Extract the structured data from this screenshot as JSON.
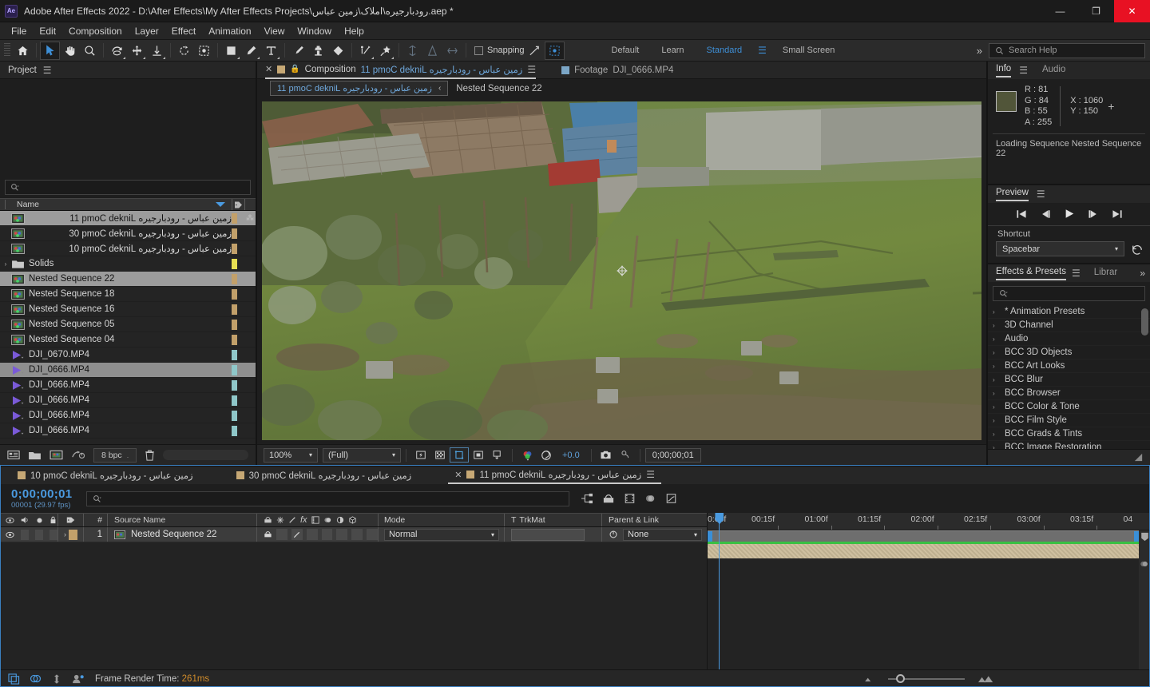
{
  "titlebar": {
    "app_icon": "ae-logo",
    "title": "Adobe After Effects 2022 - D:\\After Effects\\My After Effects Projects\\رودبارجیره\\املاک\\زمین عباس.aep *",
    "minimize": "—",
    "maximize": "❐",
    "close": "✕"
  },
  "menubar": {
    "items": [
      "File",
      "Edit",
      "Composition",
      "Layer",
      "Effect",
      "Animation",
      "View",
      "Window",
      "Help"
    ]
  },
  "toolbar": {
    "snapping_label": "Snapping",
    "workspaces": [
      "Default",
      "Learn",
      "Standard",
      "Small Screen"
    ],
    "selected_workspace": "Standard",
    "overflow": "»",
    "help_placeholder": "Search Help"
  },
  "project": {
    "tab_label": "Project",
    "search_placeholder": "",
    "columns": [
      "Name"
    ],
    "items": [
      {
        "name": "زمین عباس - رودبارجیره Linked Comp 11",
        "type": "comp",
        "swatch": "#c2a06a",
        "selected": true,
        "rtl": true,
        "hierarchy": true
      },
      {
        "name": "زمین عباس - رودبارجیره Linked Comp 03",
        "type": "comp",
        "swatch": "#c2a06a",
        "selected": false,
        "rtl": true
      },
      {
        "name": "زمین عباس - رودبارجیره Linked Comp 01",
        "type": "comp",
        "swatch": "#c2a06a",
        "selected": false,
        "rtl": true
      },
      {
        "name": "Solids",
        "type": "folder",
        "swatch": "#e8df52",
        "selected": false,
        "twisty": true
      },
      {
        "name": "Nested Sequence 22",
        "type": "comp",
        "swatch": "#c2a06a",
        "selected": true
      },
      {
        "name": "Nested Sequence 18",
        "type": "comp",
        "swatch": "#c2a06a",
        "selected": false
      },
      {
        "name": "Nested Sequence 16",
        "type": "comp",
        "swatch": "#c2a06a",
        "selected": false
      },
      {
        "name": "Nested Sequence 05",
        "type": "comp",
        "swatch": "#c2a06a",
        "selected": false
      },
      {
        "name": "Nested Sequence 04",
        "type": "comp",
        "swatch": "#c2a06a",
        "selected": false
      },
      {
        "name": "DJI_0670.MP4",
        "type": "video",
        "swatch": "#8fc7c9",
        "selected": false
      },
      {
        "name": "DJI_0666.MP4",
        "type": "video",
        "swatch": "#8fc7c9",
        "selected": true
      },
      {
        "name": "DJI_0666.MP4",
        "type": "video",
        "swatch": "#8fc7c9",
        "selected": false
      },
      {
        "name": "DJI_0666.MP4",
        "type": "video",
        "swatch": "#8fc7c9",
        "selected": false
      },
      {
        "name": "DJI_0666.MP4",
        "type": "video",
        "swatch": "#8fc7c9",
        "selected": false
      },
      {
        "name": "DJI_0666.MP4",
        "type": "video",
        "swatch": "#8fc7c9",
        "selected": false
      }
    ],
    "footer": {
      "bit_depth": "8 bpc"
    }
  },
  "viewer": {
    "tabs": [
      {
        "label_prefix": "Composition",
        "label_rtl": "زمین عباس - رودبارجیره Linked Comp 11",
        "active": true,
        "closable": true,
        "locked": true
      },
      {
        "label_prefix": "Footage",
        "label_rtl": "DJI_0666.MP4",
        "active": false,
        "closable": false,
        "locked": false
      }
    ],
    "breadcrumb": {
      "current": "زمین عباس - رودبارجیره Linked Comp 11",
      "chevron": "‹",
      "next": "Nested Sequence 22"
    },
    "footer": {
      "zoom": "100%",
      "resolution": "(Full)",
      "exposure": "+0.0",
      "timecode": "0;00;00;01"
    }
  },
  "info": {
    "tabs": [
      "Info",
      "Audio"
    ],
    "active_tab": "Info",
    "color_swatch": "#515539",
    "r_label": "R :",
    "r_value": "81",
    "g_label": "G :",
    "g_value": "84",
    "b_label": "B :",
    "b_value": "55",
    "a_label": "A :",
    "a_value": "255",
    "x_label": "X :",
    "x_value": "1060",
    "y_label": "Y :",
    "y_value": "150",
    "status": "Loading Sequence Nested Sequence 22"
  },
  "preview": {
    "tab_label": "Preview",
    "shortcut_label": "Shortcut",
    "shortcut_value": "Spacebar"
  },
  "effects": {
    "tabs": [
      "Effects & Presets",
      "Librar"
    ],
    "active_tab": "Effects & Presets",
    "search_placeholder": "",
    "categories": [
      "* Animation Presets",
      "3D Channel",
      "Audio",
      "BCC 3D Objects",
      "BCC Art Looks",
      "BCC Blur",
      "BCC Browser",
      "BCC Color & Tone",
      "BCC Film Style",
      "BCC Grads & Tints",
      "BCC Image Restoration"
    ]
  },
  "timeline": {
    "tabs": [
      {
        "label": "زمین عباس - رودبارجیره Linked Comp 01",
        "active": false,
        "closable": false
      },
      {
        "label": "زمین عباس - رودبارجیره Linked Comp 03",
        "active": false,
        "closable": false
      },
      {
        "label": "زمین عباس - رودبارجیره Linked Comp 11",
        "active": true,
        "closable": true
      }
    ],
    "timecode": "0;00;00;01",
    "frame_info": "00001 (29.97 fps)",
    "search_placeholder": "",
    "columns": {
      "source_name": "Source Name",
      "mode": "Mode",
      "t": "T",
      "trkmat": "TrkMat",
      "parent_link": "Parent & Link",
      "hash": "#"
    },
    "layers": [
      {
        "index": "1",
        "name": "Nested Sequence 22",
        "mode": "Normal",
        "trkmat": "",
        "parent": "None",
        "label_color": "#c2a06a"
      }
    ],
    "ruler_ticks": [
      "00:15f",
      "01:00f",
      "01:15f",
      "02:00f",
      "02:15f",
      "03:00f",
      "03:15f",
      "04"
    ],
    "ruler_start": "0:00f",
    "playhead_position_pct": 1.2
  },
  "statusbar": {
    "render_label": "Frame Render Time:",
    "render_value": "261ms"
  },
  "colors": {
    "accent_blue": "#4a9ae0",
    "label_tan": "#c2a06a",
    "label_teal": "#8fc7c9",
    "close_red": "#e81123",
    "render_orange": "#d08b2a",
    "green_bar": "#39c043"
  }
}
